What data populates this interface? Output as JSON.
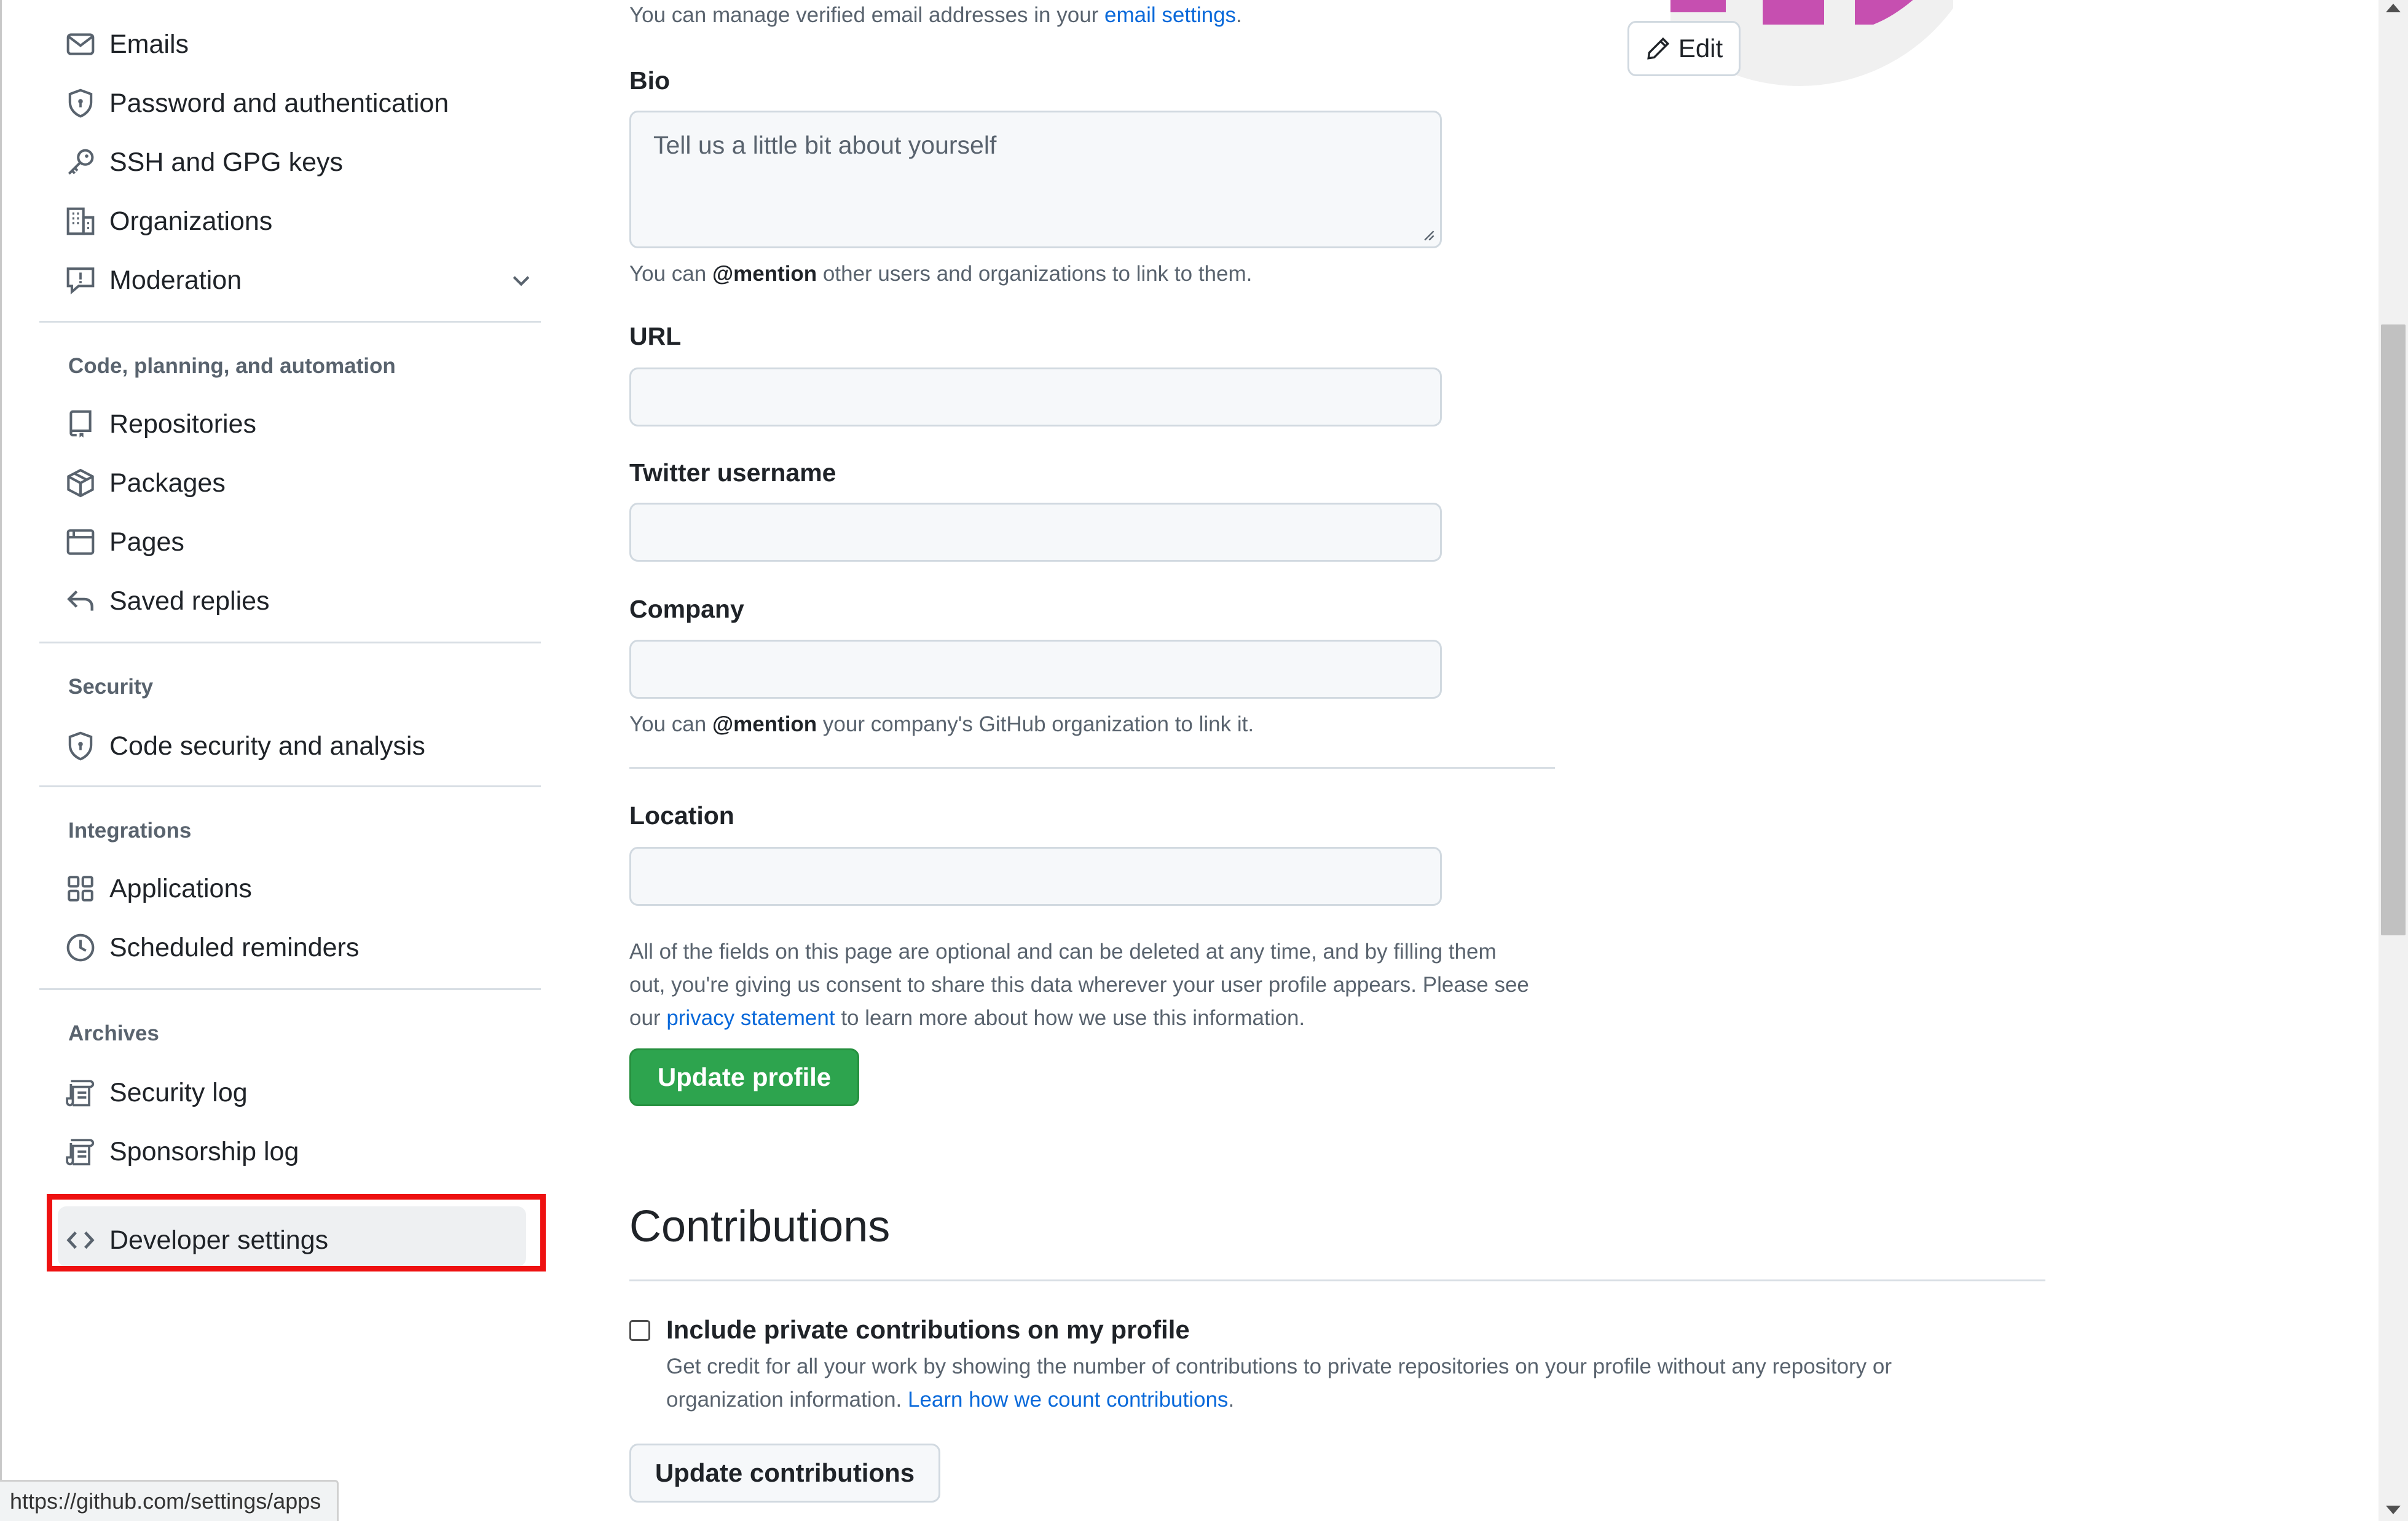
{
  "sidebar": {
    "items_top": [
      {
        "label": "Emails",
        "icon": "mail-icon"
      },
      {
        "label": "Password and authentication",
        "icon": "shield-lock-icon"
      },
      {
        "label": "SSH and GPG keys",
        "icon": "key-icon"
      },
      {
        "label": "Organizations",
        "icon": "organization-icon"
      },
      {
        "label": "Moderation",
        "icon": "report-icon"
      }
    ],
    "section_code": {
      "title": "Code, planning, and automation",
      "items": [
        {
          "label": "Repositories",
          "icon": "repo-icon"
        },
        {
          "label": "Packages",
          "icon": "package-icon"
        },
        {
          "label": "Pages",
          "icon": "browser-icon"
        },
        {
          "label": "Saved replies",
          "icon": "reply-icon"
        }
      ]
    },
    "section_security": {
      "title": "Security",
      "items": [
        {
          "label": "Code security and analysis",
          "icon": "shield-lock-icon"
        }
      ]
    },
    "section_integrations": {
      "title": "Integrations",
      "items": [
        {
          "label": "Applications",
          "icon": "apps-icon"
        },
        {
          "label": "Scheduled reminders",
          "icon": "clock-icon"
        }
      ]
    },
    "section_archives": {
      "title": "Archives",
      "items": [
        {
          "label": "Security log",
          "icon": "log-icon"
        },
        {
          "label": "Sponsorship log",
          "icon": "log-icon"
        }
      ]
    },
    "developer_settings": {
      "label": "Developer settings",
      "icon": "code-icon"
    }
  },
  "form": {
    "email_note_prefix": "You can manage verified email addresses in your ",
    "email_note_link": "email settings",
    "email_note_suffix": ".",
    "bio_label": "Bio",
    "bio_placeholder": "Tell us a little bit about yourself",
    "bio_help_prefix": "You can ",
    "bio_help_mention": "@mention",
    "bio_help_suffix": " other users and organizations to link to them.",
    "url_label": "URL",
    "url_value": "",
    "twitter_label": "Twitter username",
    "twitter_value": "",
    "company_label": "Company",
    "company_value": "",
    "company_help_prefix": "You can ",
    "company_help_mention": "@mention",
    "company_help_suffix": " your company's GitHub organization to link it.",
    "location_label": "Location",
    "location_value": "",
    "optional_note_1": "All of the fields on this page are optional and can be deleted at any time, and by filling them",
    "optional_note_2": "out, you're giving us consent to share this data wherever your user profile appears. Please see",
    "optional_note_3_prefix": "our ",
    "optional_note_3_link": "privacy statement",
    "optional_note_3_suffix": " to learn more about how we use this information.",
    "update_profile_label": "Update profile"
  },
  "contributions": {
    "heading": "Contributions",
    "checkbox_label": "Include private contributions on my profile",
    "checkbox_checked": false,
    "desc_line1": "Get credit for all your work by showing the number of contributions to private repositories on your profile without any repository or",
    "desc_line2_prefix": "organization information. ",
    "desc_line2_link": "Learn how we count contributions",
    "desc_line2_suffix": ".",
    "update_label": "Update contributions"
  },
  "avatar": {
    "edit_label": "Edit",
    "accent_color": "#c64fb0"
  },
  "statusbar": {
    "url": "https://github.com/settings/apps"
  },
  "colors": {
    "link": "#0969da",
    "primary_button": "#2da44e",
    "highlight": "#ee1111"
  }
}
